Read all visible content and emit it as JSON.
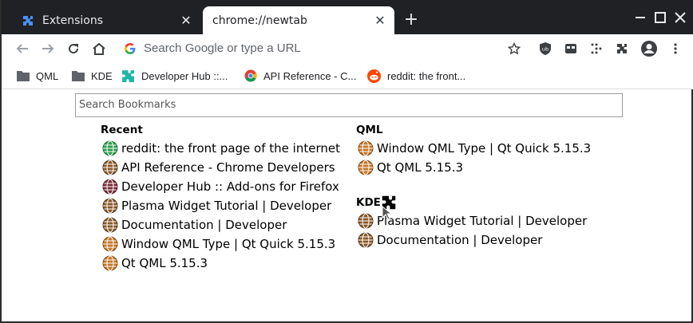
{
  "tabs": [
    {
      "title": "Extensions",
      "icon": "puzzle-icon",
      "active": false
    },
    {
      "title": "chrome://newtab",
      "active": true
    }
  ],
  "omnibox": {
    "placeholder": "Search Google or type a URL"
  },
  "bookmarks_bar": [
    {
      "label": "QML",
      "icon": "folder-icon"
    },
    {
      "label": "KDE",
      "icon": "folder-icon"
    },
    {
      "label": "Developer Hub ::...",
      "icon": "puzzle-teal-icon"
    },
    {
      "label": "API Reference - C...",
      "icon": "chrome-icon"
    },
    {
      "label": "reddit: the front...",
      "icon": "reddit-icon"
    }
  ],
  "search": {
    "placeholder": "Search Bookmarks"
  },
  "columns": {
    "recent": {
      "heading": "Recent",
      "items": [
        {
          "title": "reddit: the front page of the internet",
          "globe": "green"
        },
        {
          "title": "API Reference - Chrome Developers",
          "globe": "brown"
        },
        {
          "title": "Developer Hub :: Add-ons for Firefox",
          "globe": "maroon"
        },
        {
          "title": "Plasma Widget Tutorial | Developer",
          "globe": "brown"
        },
        {
          "title": "Documentation | Developer",
          "globe": "brown"
        },
        {
          "title": "Window QML Type | Qt Quick 5.15.3",
          "globe": "orange"
        },
        {
          "title": "Qt QML 5.15.3",
          "globe": "orange"
        }
      ]
    },
    "qml": {
      "heading": "QML",
      "items": [
        {
          "title": "Window QML Type | Qt Quick 5.15.3",
          "globe": "orange"
        },
        {
          "title": "Qt QML 5.15.3",
          "globe": "orange"
        }
      ]
    },
    "kde": {
      "heading": "KDE",
      "items": [
        {
          "title": "Plasma Widget Tutorial | Developer",
          "globe": "brown"
        },
        {
          "title": "Documentation | Developer",
          "globe": "brown"
        }
      ]
    }
  },
  "colors": {
    "tabstrip": "#202124",
    "globe_green": "#2e9e4f",
    "globe_brown": "#8a5a2b",
    "globe_maroon": "#7a2e3a",
    "globe_orange": "#c4782a",
    "teal": "#1fb5a7",
    "reddit": "#ff4500"
  }
}
